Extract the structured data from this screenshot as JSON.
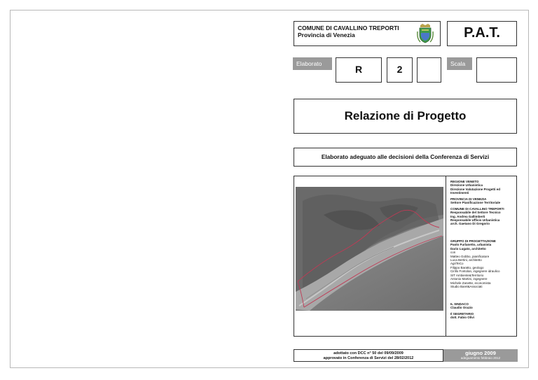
{
  "comune": {
    "name": "COMUNE DI CAVALLINO TREPORTI",
    "provincia": "Provincia di Venezia"
  },
  "plan": {
    "name": "P.A.T."
  },
  "elaborato": {
    "label": "Elaborato",
    "code_1": "R",
    "code_2": "2",
    "code_3": ""
  },
  "scala": {
    "label": "Scala",
    "value": ""
  },
  "title": "Relazione di Progetto",
  "subtitle": "Elaborato adeguato alle decisioni della Conferenza di Servizi",
  "credits": {
    "regione": [
      "REGIONE VENETO",
      "Direzione Urbanistica",
      "Direzione Valutazione Progetti ed",
      "Investimenti"
    ],
    "provincia": [
      "PROVINCIA DI VENEZIA",
      "Settore Pianificazione Territoriale"
    ],
    "comune": [
      "COMUNE DI CAVALLINO TREPORTI",
      "Responsabile del Settore Tecnico",
      "Ing. Andrea Gallimberti",
      "Responsabile Ufficio Urbanistica",
      "arch. Gaetano Di Gregorio"
    ],
    "gruppo_bold": [
      "GRUPPO DI PROGETTAZIONE",
      "Paolo Furlanetto, urbanista",
      "Dario Lugato, architetto"
    ],
    "gruppo_con": "con",
    "gruppo": [
      "Matteo Gobbo, pianificatore",
      "Luca Bertini, architetto",
      "AgriTeCo",
      "Filippo Baratto, geologo",
      "Cirillo Fontolan, ingegnere idraulico",
      "SIT Ambiente&Territorio",
      "Antonio Martini, ingegnere",
      "Michele Zanette, economista",
      "Studio Barel&Associati"
    ],
    "sindaco": [
      "IL SINDACO",
      "Claudio Orazio"
    ],
    "segretario": [
      "Il SEGRETARIO",
      "dott. Fabio Olivi"
    ]
  },
  "footer": {
    "adottato": "adottato con DCC n° 50 del 09/09/2009",
    "approvato": "approvato in Conferenza di Servizi del 28/02/2012",
    "date": "giugno 2009",
    "adeguamento": "adeguamento febbraio 2012"
  },
  "colors": {
    "gray_label": "#9a9a9a",
    "border": "#333333",
    "boundary": "#c03a55"
  }
}
